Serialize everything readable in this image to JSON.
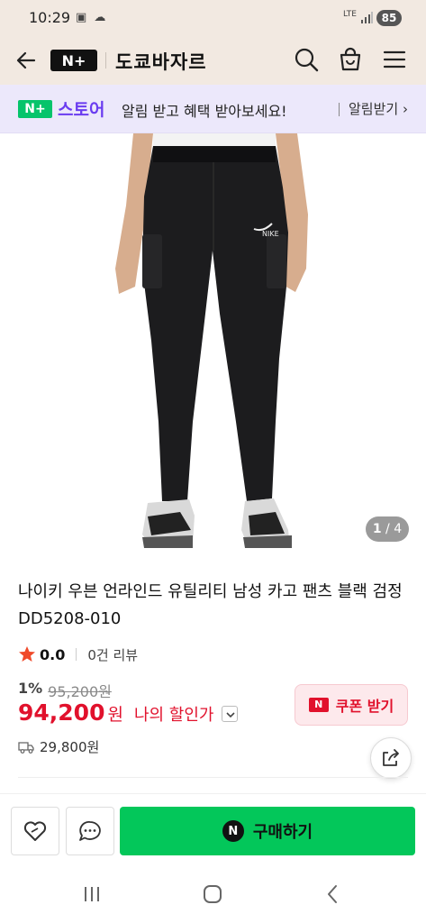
{
  "status_bar": {
    "time": "10:29",
    "network": "LTE",
    "battery": "85"
  },
  "header": {
    "logo": "N+",
    "store_name": "도쿄바자르"
  },
  "promo": {
    "logo": "N+",
    "store_label": "스토어",
    "message": "알림 받고 혜택 받아보세요!",
    "action": "알림받기"
  },
  "gallery": {
    "current": "1",
    "separator": "/",
    "total": "4"
  },
  "product": {
    "title": "나이키 우븐 언라인드 유틸리티 남성 카고 팬츠 블랙 검정 DD5208-010",
    "rating": "0.0",
    "reviews": "0건 리뷰",
    "discount_rate": "1%",
    "original_price": "95,200원",
    "price": "94,200",
    "price_unit": "원",
    "my_discount": "나의 할인가",
    "shipping_fee": "29,800원"
  },
  "coupon": {
    "icon": "N",
    "label": "쿠폰 받기"
  },
  "buy": {
    "icon": "N",
    "label": "구매하기"
  },
  "colors": {
    "brand_green": "#03c75a",
    "price_red": "#e1112c",
    "promo_purple": "#6a3cf0",
    "header_bg": "#f2e9e1"
  },
  "icons": [
    "back-arrow-icon",
    "search-icon",
    "shopping-bag-icon",
    "menu-icon",
    "star-icon",
    "truck-icon",
    "share-icon",
    "heart-icon",
    "chat-icon"
  ]
}
